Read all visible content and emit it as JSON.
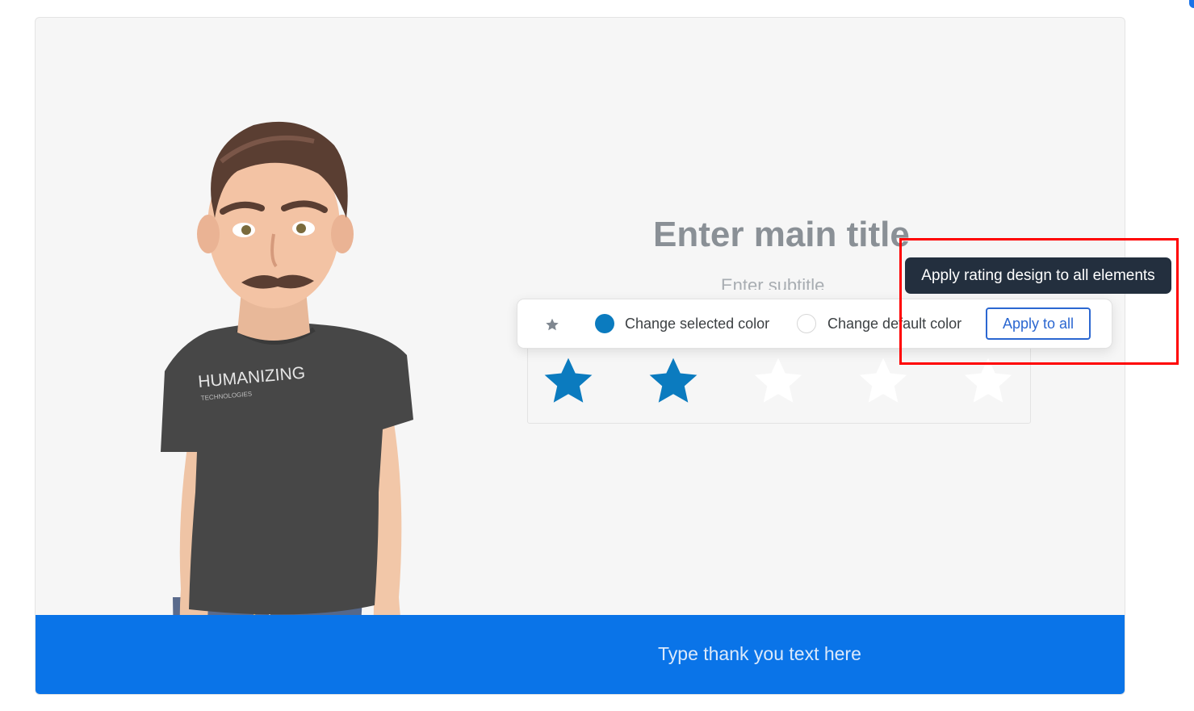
{
  "theme": {
    "accent": "#0a74e8",
    "selected_star_color": "#0b7bbf",
    "default_star_color": "#ffffff",
    "tooltip_bg": "#232f3e",
    "highlight_color": "#ff0000"
  },
  "form": {
    "main_title": "Enter main title",
    "sub_title": "Enter subtitle",
    "footer_text": "Type thank you text here"
  },
  "avatar": {
    "shirt_brand": "HUMANIZING",
    "shirt_sub": "TECHNOLOGIES"
  },
  "rating": {
    "max": 5,
    "value": 2,
    "icon": "star-icon"
  },
  "toolbar": {
    "icon": "star-icon",
    "selected_color_label": "Change selected color",
    "default_color_label": "Change default color",
    "apply_button": "Apply to all",
    "tooltip": "Apply rating design to all elements"
  }
}
